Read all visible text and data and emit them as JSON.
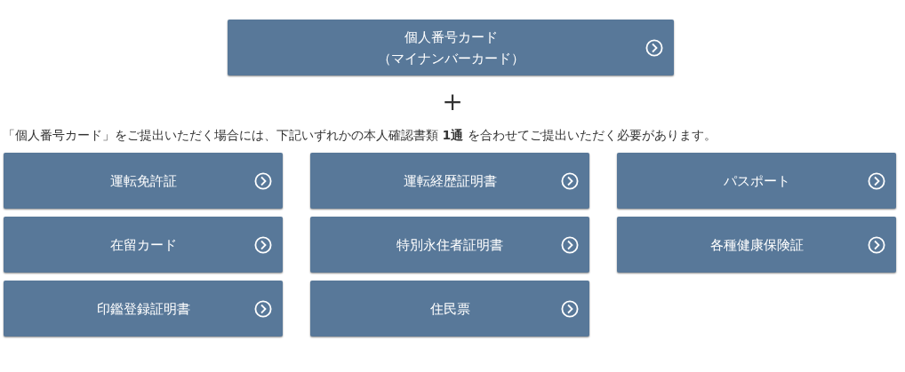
{
  "main_card": {
    "lines": [
      "個人番号カード",
      "（マイナンバーカード）"
    ]
  },
  "plus": "＋",
  "note": "「個人番号カード」をご提出いただく場合には、下記いずれかの本人確認書類 **1通** を合わせてご提出いただく必要があります。",
  "documents": [
    {
      "label": "運転免許証"
    },
    {
      "label": "運転経歴証明書"
    },
    {
      "label": "パスポート"
    },
    {
      "label": "在留カード"
    },
    {
      "label": "特別永住者証明書"
    },
    {
      "label": "各種健康保険証"
    },
    {
      "label": "印鑑登録証明書"
    },
    {
      "label": "住民票"
    }
  ]
}
